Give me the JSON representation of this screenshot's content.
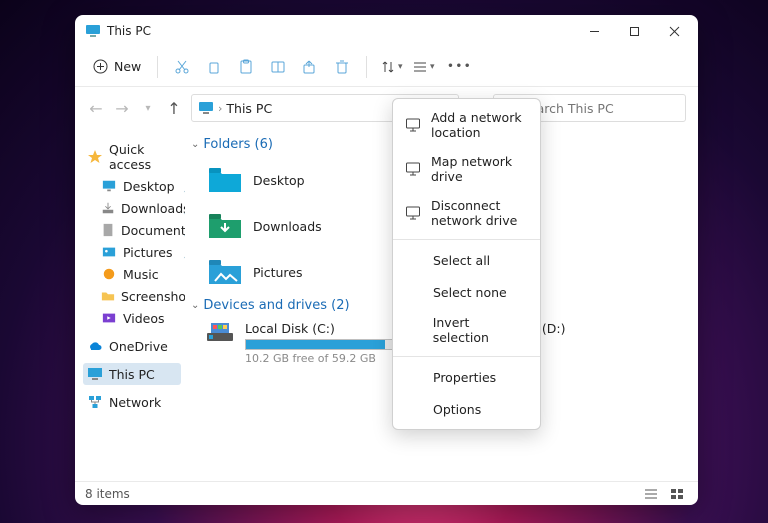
{
  "window": {
    "title": "This PC"
  },
  "toolbar": {
    "new_label": "New"
  },
  "address": {
    "location": "This PC"
  },
  "search": {
    "placeholder": "Search This PC"
  },
  "sidebar": {
    "quick_access": "Quick access",
    "items": [
      {
        "label": "Desktop",
        "icon": "desktop",
        "pinned": true
      },
      {
        "label": "Downloads",
        "icon": "downloads",
        "pinned": true
      },
      {
        "label": "Documents",
        "icon": "documents",
        "pinned": true
      },
      {
        "label": "Pictures",
        "icon": "pictures",
        "pinned": true
      },
      {
        "label": "Music",
        "icon": "music",
        "pinned": false
      },
      {
        "label": "Screenshots",
        "icon": "folder",
        "pinned": false
      },
      {
        "label": "Videos",
        "icon": "videos",
        "pinned": false
      }
    ],
    "onedrive": "OneDrive",
    "this_pc": "This PC",
    "network": "Network"
  },
  "sections": {
    "folders": {
      "label": "Folders",
      "count": 6
    },
    "drives": {
      "label": "Devices and drives",
      "count": 2
    }
  },
  "folders": [
    {
      "label": "Desktop",
      "icon": "desktop"
    },
    {
      "label": "Downloads",
      "icon": "downloads"
    },
    {
      "label": "Pictures",
      "icon": "pictures"
    }
  ],
  "drives": [
    {
      "label": "Local Disk (C:)",
      "free_text": "10.2 GB free of 59.2 GB",
      "used_pct": 83
    },
    {
      "label": "DVD Drive (D:)",
      "free_text": ""
    }
  ],
  "context_menu": {
    "groups": [
      [
        {
          "label": "Add a network location",
          "icon": "monitor-plus"
        },
        {
          "label": "Map network drive",
          "icon": "monitor-net"
        },
        {
          "label": "Disconnect network drive",
          "icon": "monitor-x"
        }
      ],
      [
        {
          "label": "Select all"
        },
        {
          "label": "Select none"
        },
        {
          "label": "Invert selection"
        }
      ],
      [
        {
          "label": "Properties"
        },
        {
          "label": "Options"
        }
      ]
    ]
  },
  "statusbar": {
    "items": "8 items"
  }
}
